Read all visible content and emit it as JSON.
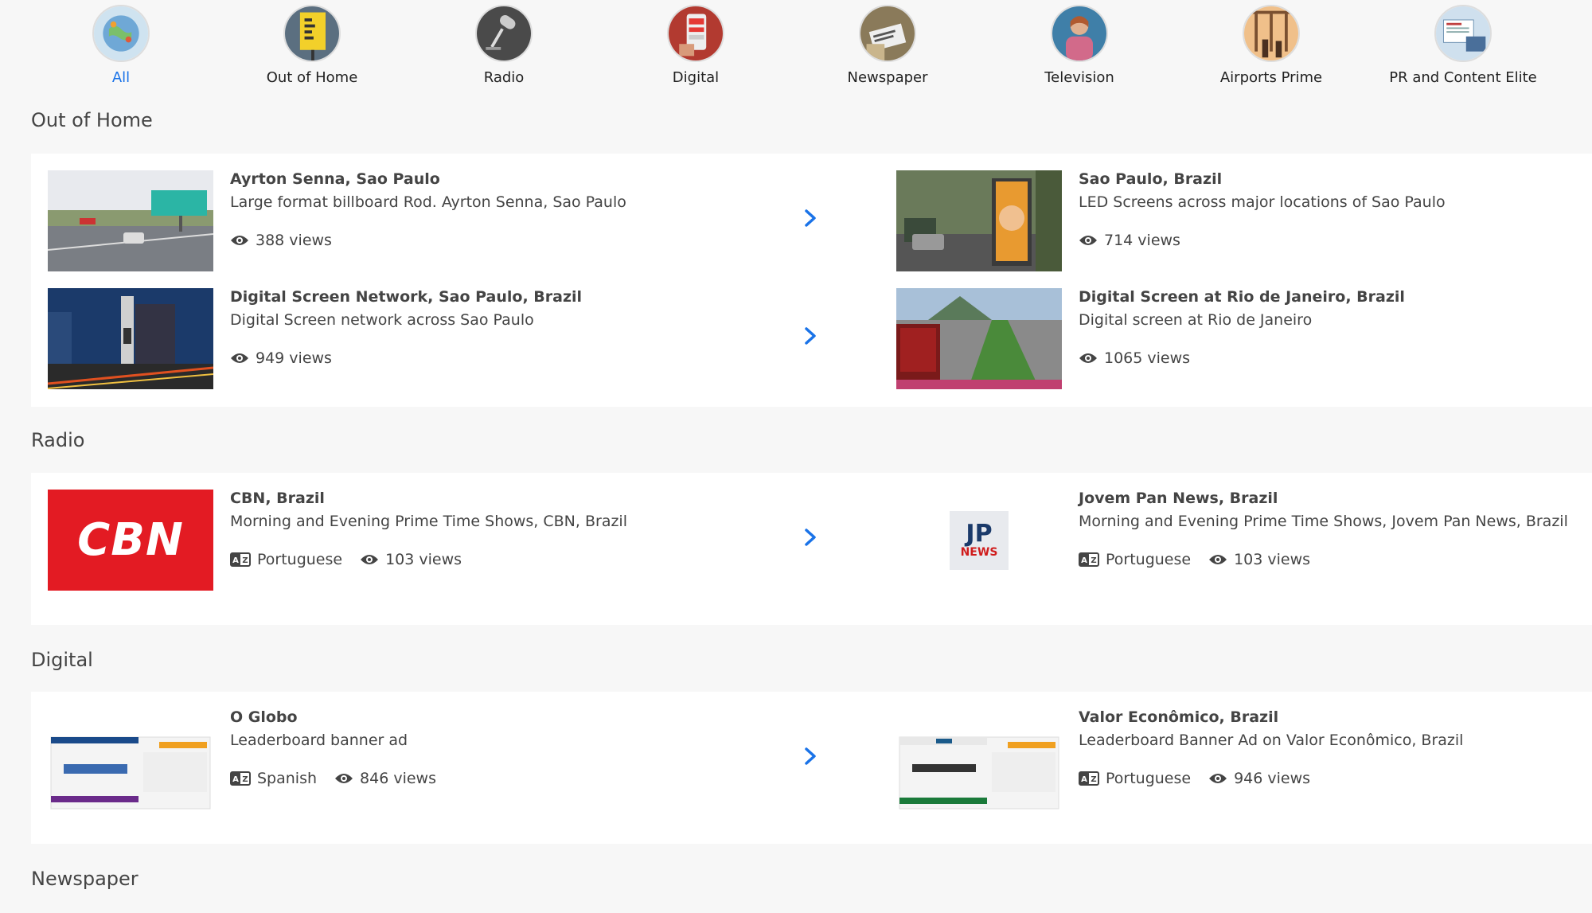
{
  "categories": [
    {
      "label": "All",
      "active": true
    },
    {
      "label": "Out of Home"
    },
    {
      "label": "Radio"
    },
    {
      "label": "Digital"
    },
    {
      "label": "Newspaper"
    },
    {
      "label": "Television"
    },
    {
      "label": "Airports Prime"
    },
    {
      "label": "PR and Content Elite"
    }
  ],
  "sections": {
    "ooh": {
      "title": "Out of Home",
      "cards": [
        {
          "title": "Ayrton Senna, Sao Paulo",
          "desc": "Large format billboard Rod. Ayrton Senna, Sao Paulo",
          "views": "388 views"
        },
        {
          "title": "Sao Paulo, Brazil",
          "desc": "LED Screens across major locations of Sao Paulo",
          "views": "714 views"
        },
        {
          "title": "Digital Screen Network, Sao Paulo, Brazil",
          "desc": "Digital Screen network across Sao Paulo",
          "views": "949 views"
        },
        {
          "title": "Digital Screen at Rio de Janeiro, Brazil",
          "desc": "Digital screen at Rio de Janeiro",
          "views": "1065 views"
        }
      ]
    },
    "radio": {
      "title": "Radio",
      "cards": [
        {
          "title": "CBN, Brazil",
          "desc": "Morning and Evening Prime Time Shows, CBN, Brazil",
          "language": "Portuguese",
          "views": "103 views",
          "logo": "CBN"
        },
        {
          "title": "Jovem Pan News, Brazil",
          "desc": "Morning and Evening Prime Time Shows, Jovem Pan News, Brazil",
          "language": "Portuguese",
          "views": "103 views",
          "logo_top": "JP",
          "logo_bottom": "NEWS"
        }
      ]
    },
    "digital": {
      "title": "Digital",
      "cards": [
        {
          "title": "O Globo",
          "desc": "Leaderboard banner ad",
          "language": "Spanish",
          "views": "846 views"
        },
        {
          "title": "Valor Econômico, Brazil",
          "desc": "Leaderboard Banner Ad on Valor Econômico, Brazil",
          "language": "Portuguese",
          "views": "946 views"
        }
      ]
    },
    "newspaper": {
      "title": "Newspaper"
    }
  },
  "colors": {
    "accent": "#1a73e8",
    "cbn_red": "#e31b23"
  }
}
